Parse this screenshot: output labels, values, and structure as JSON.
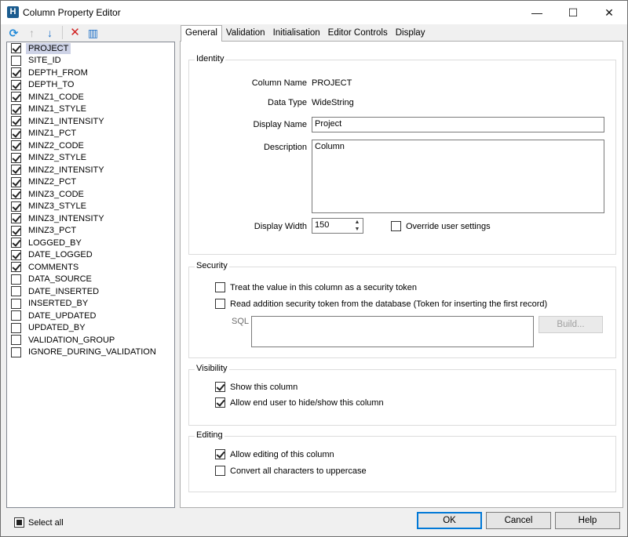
{
  "window": {
    "title": "Column Property Editor",
    "app_icon_letter": "H",
    "controls": {
      "minimize": "—",
      "maximize": "☐",
      "close": "✕"
    }
  },
  "toolbar": {
    "icons": [
      "refresh-icon",
      "arrow-up-icon",
      "arrow-down-icon",
      "delete-icon",
      "column-chooser-icon"
    ],
    "glyphs": {
      "refresh": "⟳",
      "up": "↑",
      "down": "↓",
      "delete": "✕",
      "cols": "▥"
    }
  },
  "columns": [
    {
      "label": "PROJECT",
      "checked": true,
      "selected": true
    },
    {
      "label": "SITE_ID",
      "checked": false
    },
    {
      "label": "DEPTH_FROM",
      "checked": true
    },
    {
      "label": "DEPTH_TO",
      "checked": true
    },
    {
      "label": "MINZ1_CODE",
      "checked": true
    },
    {
      "label": "MINZ1_STYLE",
      "checked": true
    },
    {
      "label": "MINZ1_INTENSITY",
      "checked": true
    },
    {
      "label": "MINZ1_PCT",
      "checked": true
    },
    {
      "label": "MINZ2_CODE",
      "checked": true
    },
    {
      "label": "MINZ2_STYLE",
      "checked": true
    },
    {
      "label": "MINZ2_INTENSITY",
      "checked": true
    },
    {
      "label": "MINZ2_PCT",
      "checked": true
    },
    {
      "label": "MINZ3_CODE",
      "checked": true
    },
    {
      "label": "MINZ3_STYLE",
      "checked": true
    },
    {
      "label": "MINZ3_INTENSITY",
      "checked": true
    },
    {
      "label": "MINZ3_PCT",
      "checked": true
    },
    {
      "label": "LOGGED_BY",
      "checked": true
    },
    {
      "label": "DATE_LOGGED",
      "checked": true
    },
    {
      "label": "COMMENTS",
      "checked": true
    },
    {
      "label": "DATA_SOURCE",
      "checked": false
    },
    {
      "label": "DATE_INSERTED",
      "checked": false
    },
    {
      "label": "INSERTED_BY",
      "checked": false
    },
    {
      "label": "DATE_UPDATED",
      "checked": false
    },
    {
      "label": "UPDATED_BY",
      "checked": false
    },
    {
      "label": "VALIDATION_GROUP",
      "checked": false
    },
    {
      "label": "IGNORE_DURING_VALIDATION",
      "checked": false
    }
  ],
  "select_all": {
    "label": "Select all",
    "state": "partial"
  },
  "tabs": [
    {
      "label": "General",
      "active": true
    },
    {
      "label": "Validation"
    },
    {
      "label": "Initialisation"
    },
    {
      "label": "Editor Controls"
    },
    {
      "label": "Display"
    }
  ],
  "identity": {
    "title": "Identity",
    "column_name_label": "Column Name",
    "column_name_value": "PROJECT",
    "data_type_label": "Data Type",
    "data_type_value": "WideString",
    "display_name_label": "Display Name",
    "display_name_value": "Project",
    "description_label": "Description",
    "description_value": "Column",
    "display_width_label": "Display Width",
    "display_width_value": "150",
    "override_label": "Override user settings",
    "override_checked": false
  },
  "security": {
    "title": "Security",
    "token_label": "Treat the value in this column as a security token",
    "token_checked": false,
    "read_label": "Read addition security token from the database (Token for inserting the first record)",
    "read_checked": false,
    "sql_label": "SQL",
    "sql_value": "",
    "build_label": "Build..."
  },
  "visibility": {
    "title": "Visibility",
    "show_label": "Show this column",
    "show_checked": true,
    "allow_hide_label": "Allow end user to hide/show this column",
    "allow_hide_checked": true
  },
  "editing": {
    "title": "Editing",
    "allow_edit_label": "Allow editing of this column",
    "allow_edit_checked": true,
    "uppercase_label": "Convert all characters to uppercase",
    "uppercase_checked": false
  },
  "buttons": {
    "ok": "OK",
    "cancel": "Cancel",
    "help": "Help"
  }
}
